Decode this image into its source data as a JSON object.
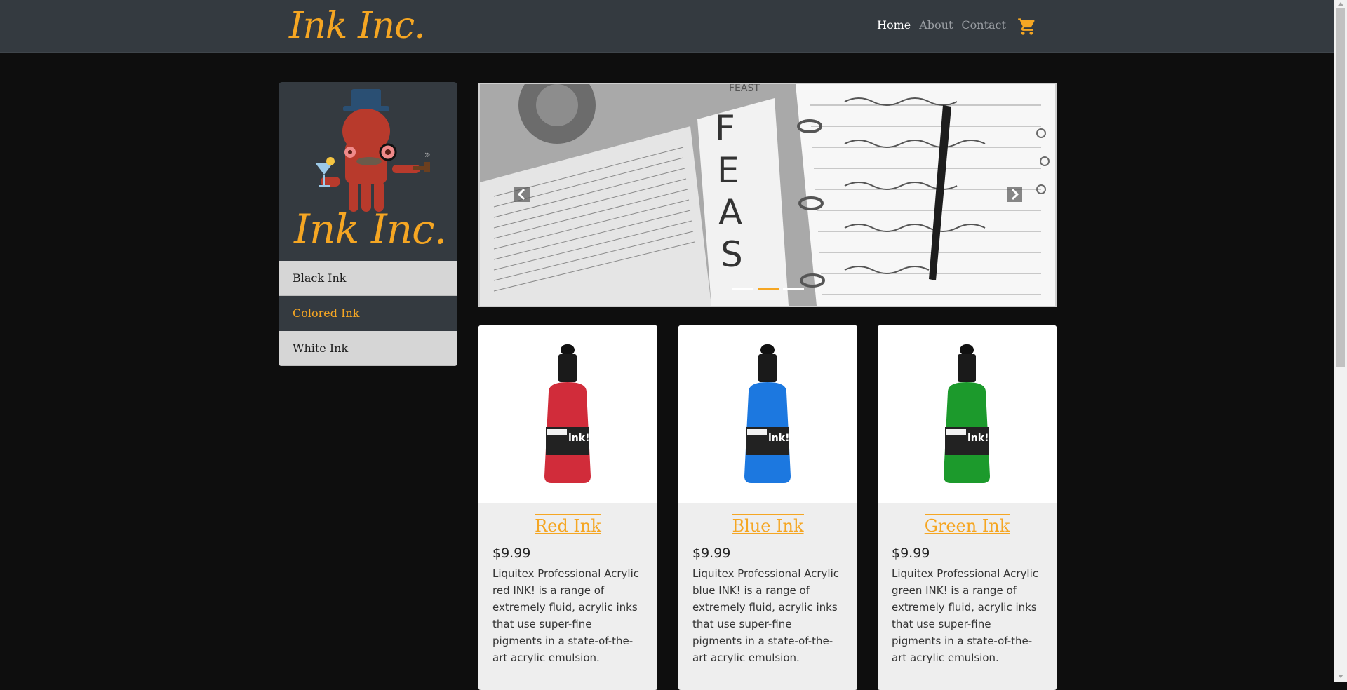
{
  "brand": {
    "name": "Ink Inc.",
    "color": "#f5a623"
  },
  "nav": {
    "items": [
      {
        "label": "Home",
        "active": true
      },
      {
        "label": "About",
        "active": false
      },
      {
        "label": "Contact",
        "active": false
      }
    ],
    "cart_icon": "shopping-cart-icon"
  },
  "sidebar": {
    "logo_text": "Ink Inc.",
    "logo_mascot": "octopus-with-top-hat",
    "items": [
      {
        "label": "Black Ink",
        "active": false
      },
      {
        "label": "Colored Ink",
        "active": true
      },
      {
        "label": "White Ink",
        "active": false
      }
    ]
  },
  "carousel": {
    "image": "notebook-and-open-bible-with-pen",
    "prev_icon": "chevron-left-icon",
    "next_icon": "chevron-right-icon",
    "slide_count": 3,
    "active_slide": 2
  },
  "products": [
    {
      "title": "Red Ink",
      "price": "$9.99",
      "description": "Liquitex Professional Acrylic red INK! is a range of extremely fluid, acrylic inks that use super-fine pigments in a state-of-the-art acrylic emulsion.",
      "color": "#d12c3a"
    },
    {
      "title": "Blue Ink",
      "price": "$9.99",
      "description": "Liquitex Professional Acrylic blue INK! is a range of extremely fluid, acrylic inks that use super-fine pigments in a state-of-the-art acrylic emulsion.",
      "color": "#1c78e0"
    },
    {
      "title": "Green Ink",
      "price": "$9.99",
      "description": "Liquitex Professional Acrylic green INK! is a range of extremely fluid, acrylic inks that use super-fine pigments in a state-of-the-art acrylic emulsion.",
      "color": "#1c9a2c"
    }
  ]
}
